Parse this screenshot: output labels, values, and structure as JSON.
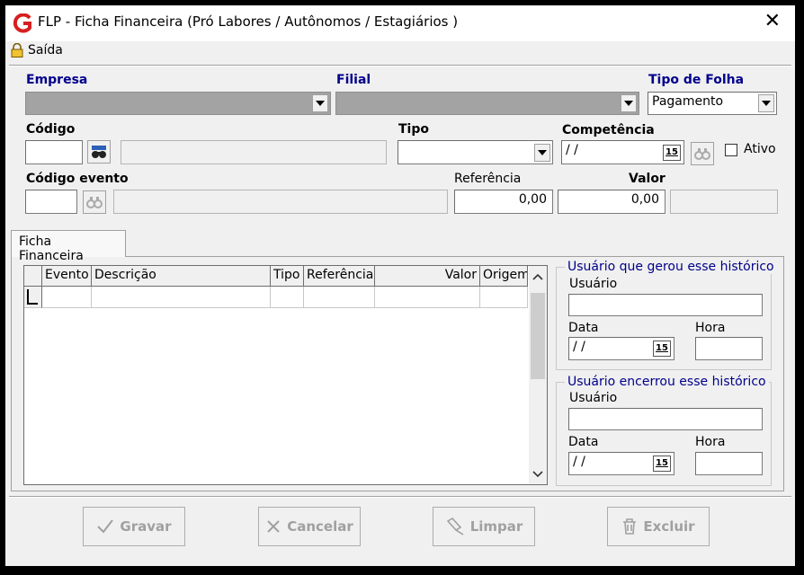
{
  "window": {
    "title": "FLP - Ficha Financeira (Pró Labores / Autônomos / Estagiários )",
    "close_glyph": "✕"
  },
  "menu": {
    "saida": "Saída"
  },
  "form": {
    "empresa_label": "Empresa",
    "filial_label": "Filial",
    "tipo_folha_label": "Tipo de Folha",
    "tipo_folha_value": "Pagamento",
    "codigo_label": "Código",
    "tipo_label": "Tipo",
    "competencia_label": "Competência",
    "competencia_value": "/ /",
    "calendar_glyph": "15",
    "ativo_label": "Ativo",
    "codigo_evento_label": "Código evento",
    "referencia_label": "Referência",
    "referencia_value": "0,00",
    "valor_label": "Valor",
    "valor_value": "0,00"
  },
  "tabs": [
    {
      "label": "Ficha Financeira"
    }
  ],
  "grid": {
    "columns": [
      "Evento",
      "Descrição",
      "Tipo",
      "Referência",
      "Valor",
      "Origem"
    ]
  },
  "created_group": {
    "title": "Usuário que gerou esse histórico",
    "usuario_label": "Usuário",
    "data_label": "Data",
    "data_value": "/ /",
    "hora_label": "Hora"
  },
  "closed_group": {
    "title": "Usuário encerrou esse histórico",
    "usuario_label": "Usuário",
    "data_label": "Data",
    "data_value": "/ /",
    "hora_label": "Hora"
  },
  "buttons": {
    "gravar": "Gravar",
    "cancelar": "Cancelar",
    "limpar": "Limpar",
    "excluir": "Excluir"
  },
  "colors": {
    "label_blue": "#00008b",
    "dark_combo": "#a3a3a3",
    "app_red": "#d62020"
  }
}
